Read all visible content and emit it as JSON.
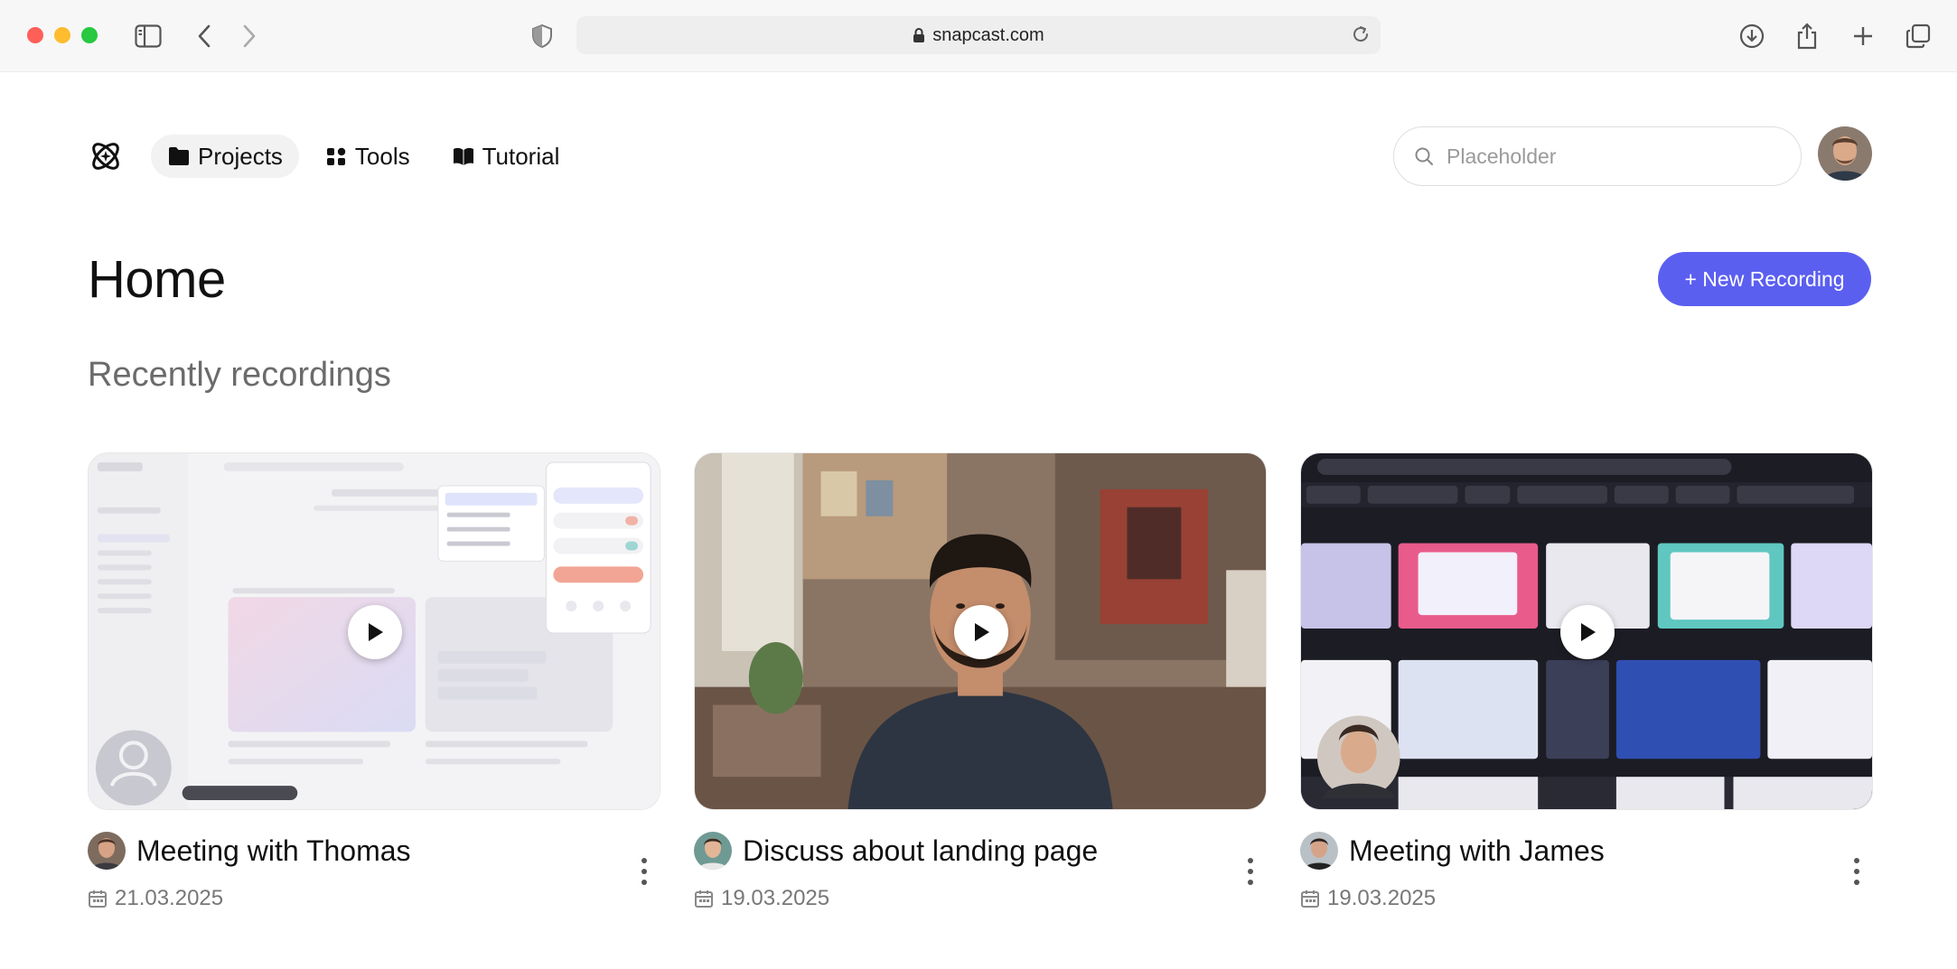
{
  "browser": {
    "url": "snapcast.com"
  },
  "nav": {
    "items": [
      {
        "label": "Projects",
        "icon": "folder-icon",
        "active": true
      },
      {
        "label": "Tools",
        "icon": "grid-icon",
        "active": false
      },
      {
        "label": "Tutorial",
        "icon": "book-icon",
        "active": false
      }
    ]
  },
  "search": {
    "placeholder": "Placeholder"
  },
  "page": {
    "title": "Home",
    "new_button": "+ New Recording",
    "section_title": "Recently recordings"
  },
  "recordings": [
    {
      "title": "Meeting with Thomas",
      "date": "21.03.2025"
    },
    {
      "title": "Discuss about landing page",
      "date": "19.03.2025"
    },
    {
      "title": "Meeting with James",
      "date": "19.03.2025"
    }
  ],
  "colors": {
    "accent": "#5b5ff0",
    "traffic_red": "#fe5f57",
    "traffic_yellow": "#febc2e",
    "traffic_green": "#28c840"
  }
}
